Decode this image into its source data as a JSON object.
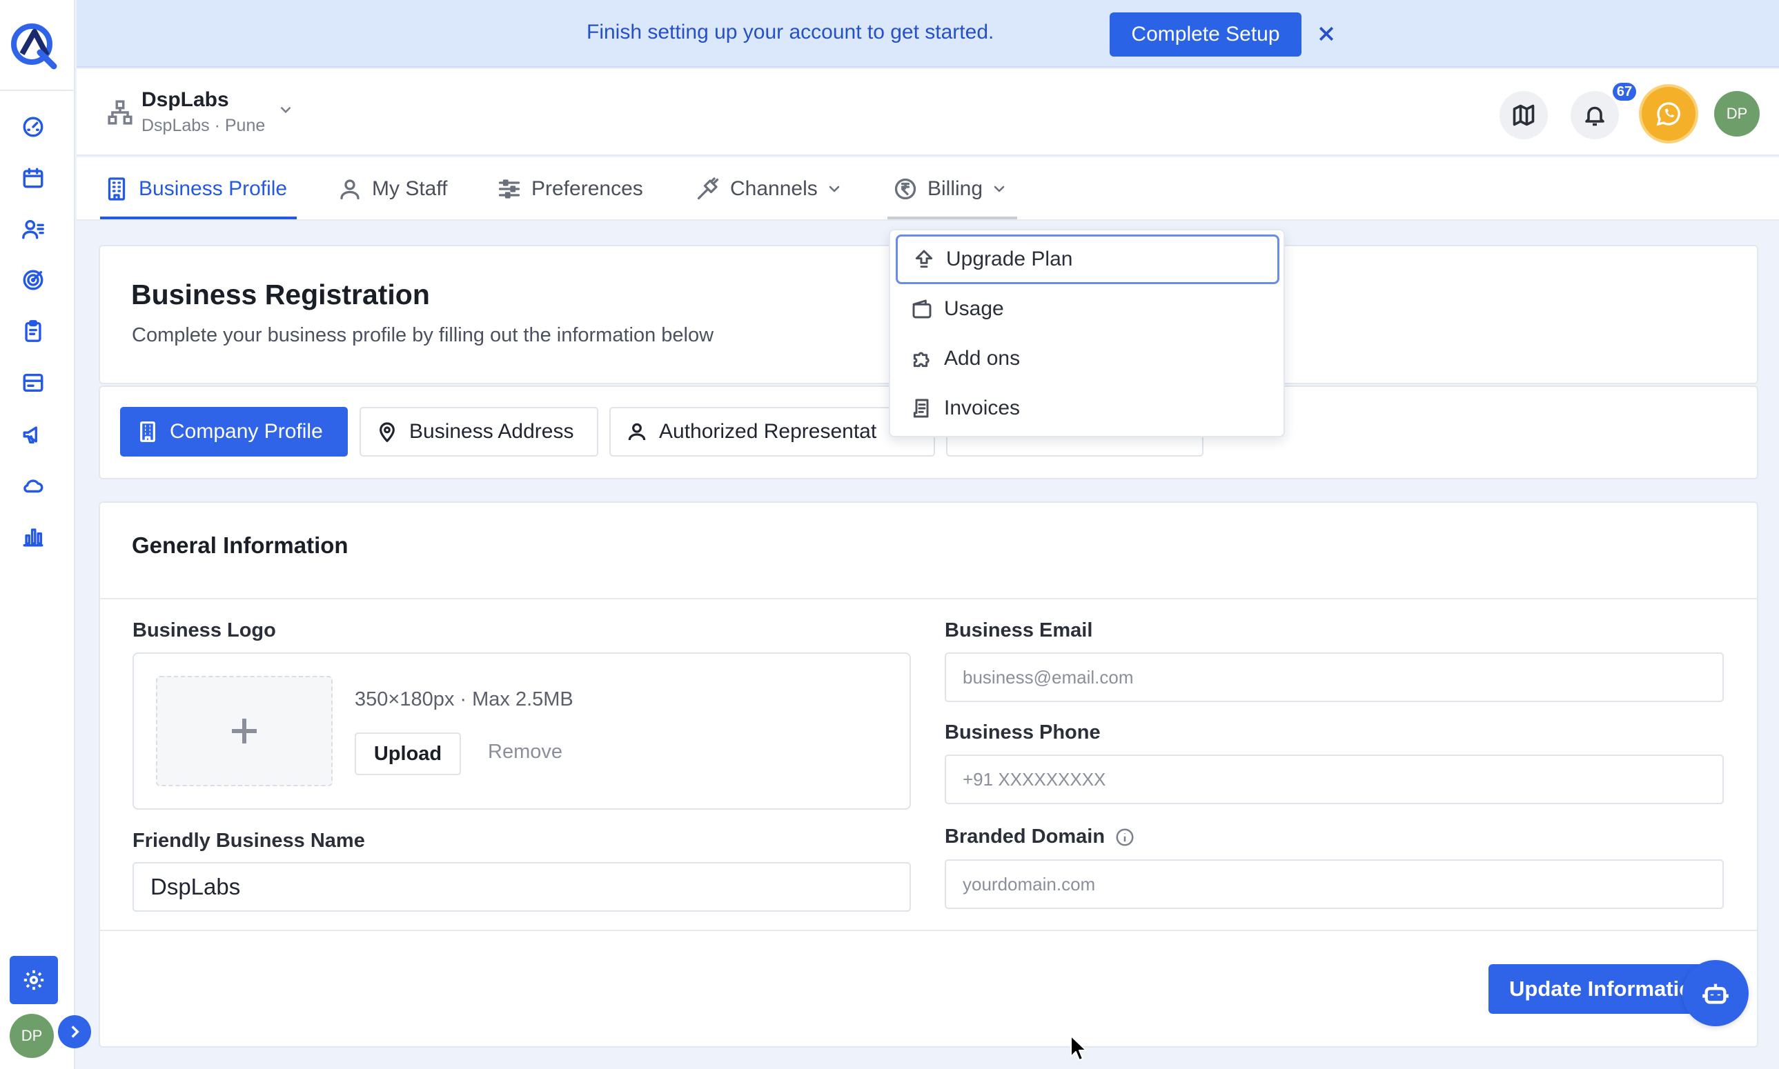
{
  "banner": {
    "message": "Finish setting up your account to get started.",
    "cta_label": "Complete Setup"
  },
  "org": {
    "name": "DspLabs",
    "subtitle": "DspLabs · Pune"
  },
  "header": {
    "notification_count": "67",
    "avatar_initials": "DP"
  },
  "tabs": [
    {
      "label": "Business Profile",
      "icon": "building-icon",
      "active": true
    },
    {
      "label": "My Staff",
      "icon": "user-icon"
    },
    {
      "label": "Preferences",
      "icon": "sliders-icon"
    },
    {
      "label": "Channels",
      "icon": "plug-icon",
      "has_dropdown": true
    },
    {
      "label": "Billing",
      "icon": "rupee-icon",
      "has_dropdown": true
    }
  ],
  "billing_menu": [
    {
      "label": "Upgrade Plan",
      "icon": "upgrade-icon"
    },
    {
      "label": "Usage",
      "icon": "wallet-icon"
    },
    {
      "label": "Add ons",
      "icon": "puzzle-icon"
    },
    {
      "label": "Invoices",
      "icon": "receipt-icon"
    }
  ],
  "registration": {
    "title": "Business Registration",
    "subtitle": "Complete your business profile by filling out the information below"
  },
  "section_tabs": [
    {
      "label": "Company Profile",
      "icon": "building-icon",
      "active": true
    },
    {
      "label": "Business Address",
      "icon": "map-pin-icon"
    },
    {
      "label": "Authorized Representat",
      "icon": "user-icon"
    }
  ],
  "general": {
    "title": "General Information",
    "logo_label": "Business Logo",
    "logo_spec": "350×180px · Max 2.5MB",
    "upload_label": "Upload",
    "remove_label": "Remove",
    "friendly_name_label": "Friendly Business Name",
    "friendly_name_value": "DspLabs",
    "email_label": "Business Email",
    "email_placeholder": "business@email.com",
    "phone_label": "Business Phone",
    "phone_placeholder": "+91 XXXXXXXXX",
    "domain_label": "Branded Domain",
    "domain_placeholder": "yourdomain.com"
  },
  "footer": {
    "update_label": "Update Informatio"
  },
  "sidebar": {
    "avatar_initials": "DP",
    "items": [
      "dashboard-icon",
      "calendar-icon",
      "contacts-icon",
      "target-icon",
      "clipboard-icon",
      "inbox-icon",
      "megaphone-icon",
      "cloud-icon",
      "bar-chart-icon"
    ]
  },
  "colors": {
    "accent": "#2f63e8",
    "banner_bg": "#dbe7fb",
    "whatsapp": "#f5b02a"
  }
}
